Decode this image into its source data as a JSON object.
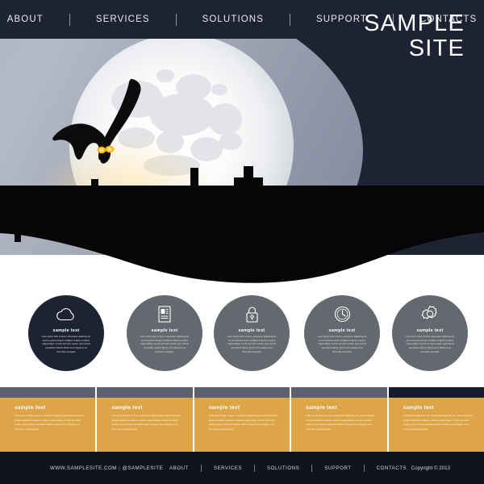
{
  "nav": {
    "items": [
      {
        "label": "ABOUT"
      },
      {
        "label": "SERVICES"
      },
      {
        "label": "SOLUTIONS"
      },
      {
        "label": "SUPPORT"
      },
      {
        "label": "CONTACTS"
      }
    ]
  },
  "hero": {
    "title_line1": "SAMPLE",
    "title_line2": "SITE",
    "illustration": "halloween-graveyard-full-moon-flying-bat",
    "colors": {
      "background": "#1d2333",
      "sky": "#a2a9b8",
      "moon": "#ffffff",
      "ground": "#050505",
      "bat_eyes": "#ffb20a"
    }
  },
  "features": {
    "circles": [
      {
        "icon": "cloud-icon",
        "title": "sample text",
        "body": "Lorem ipsum dolor sit amet, consectetur adipiscing elit, sed do eiusmod tempor incididunt ut labore et dolore magna aliqua. Ut enim ad minim veniam, quis nostrud exercitation ullamco laboris nisi ut aliquip ex ea commodo consequat.",
        "theme": "dark",
        "color": "#1d2333"
      },
      {
        "icon": "document-icon",
        "title": "sample text",
        "body": "Lorem ipsum dolor sit amet, consectetur adipiscing elit, sed do eiusmod tempor incididunt ut labore et dolore magna aliqua. Ut enim ad minim veniam, quis nostrud exercitation ullamco laboris nisi ut aliquip ex ea commodo consequat.",
        "theme": "gray",
        "color": "#64686f"
      },
      {
        "icon": "lock-icon",
        "title": "sample text",
        "body": "Lorem ipsum dolor sit amet, consectetur adipiscing elit, sed do eiusmod tempor incididunt ut labore et dolore magna aliqua. Ut enim ad minim veniam, quis nostrud exercitation ullamco laboris nisi ut aliquip ex ea commodo consequat.",
        "theme": "gray",
        "color": "#64686f"
      },
      {
        "icon": "clock-icon",
        "title": "sample text",
        "body": "Lorem ipsum dolor sit amet, consectetur adipiscing elit, sed do eiusmod tempor incididunt ut labore et dolore magna aliqua. Ut enim ad minim veniam, quis nostrud exercitation ullamco laboris nisi ut aliquip ex ea commodo consequat.",
        "theme": "gray",
        "color": "#64686f"
      },
      {
        "icon": "gear-icon",
        "title": "sample text",
        "body": "Lorem ipsum dolor sit amet, consectetur adipiscing elit, sed do eiusmod tempor incididunt ut labore et dolore magna aliqua. Ut enim ad minim veniam, quis nostrud exercitation ullamco laboris nisi ut aliquip ex ea commodo consequat.",
        "theme": "gray",
        "color": "#64686f"
      }
    ]
  },
  "panels": {
    "accent_color": "#dda548",
    "bar_color": "#5d616e",
    "last_bar_color": "#161c2a",
    "items": [
      {
        "title": "sample text",
        "body": "Lorem ipsum dolor sit amet, consectetur adipiscing elit, sed do eiusmod tempor incididunt ut labore et dolore magna aliqua. Ut enim ad minim veniam, quis nostrud exercitation ullamco laboris nisi ut aliquip ex ea commodo consequat duis."
      },
      {
        "title": "sample text",
        "body": "Lorem ipsum dolor sit amet, consectetur adipiscing elit, sed do eiusmod tempor incididunt ut labore et dolore magna aliqua. Ut enim ad minim veniam, quis nostrud exercitation ullamco laboris nisi ut aliquip ex ea commodo consequat duis."
      },
      {
        "title": "sample text",
        "body": "Lorem ipsum dolor sit amet, consectetur adipiscing elit, sed do eiusmod tempor incididunt ut labore et dolore magna aliqua. Ut enim ad minim veniam, quis nostrud exercitation ullamco laboris nisi ut aliquip ex ea commodo consequat duis."
      },
      {
        "title": "sample text",
        "body": "Lorem ipsum dolor sit amet, consectetur adipiscing elit, sed do eiusmod tempor incididunt ut labore et dolore magna aliqua. Ut enim ad minim veniam, quis nostrud exercitation ullamco laboris nisi ut aliquip ex ea commodo consequat duis."
      },
      {
        "title": "sample text",
        "body": "Lorem ipsum dolor sit amet, consectetur adipiscing elit, sed do eiusmod tempor incididunt ut labore et dolore magna aliqua. Ut enim ad minim veniam, quis nostrud exercitation ullamco laboris nisi ut aliquip ex ea commodo consequat duis."
      }
    ]
  },
  "footer": {
    "website": "WWW.SAMPLESITE.COM",
    "separator": "|",
    "social": "@SAMPLESITE",
    "links": [
      {
        "label": "ABOUT"
      },
      {
        "label": "SERVICES"
      },
      {
        "label": "SOLUTIONS"
      },
      {
        "label": "SUPPORT"
      },
      {
        "label": "CONTACTS"
      }
    ],
    "copyright": "Copyright © 2013"
  }
}
